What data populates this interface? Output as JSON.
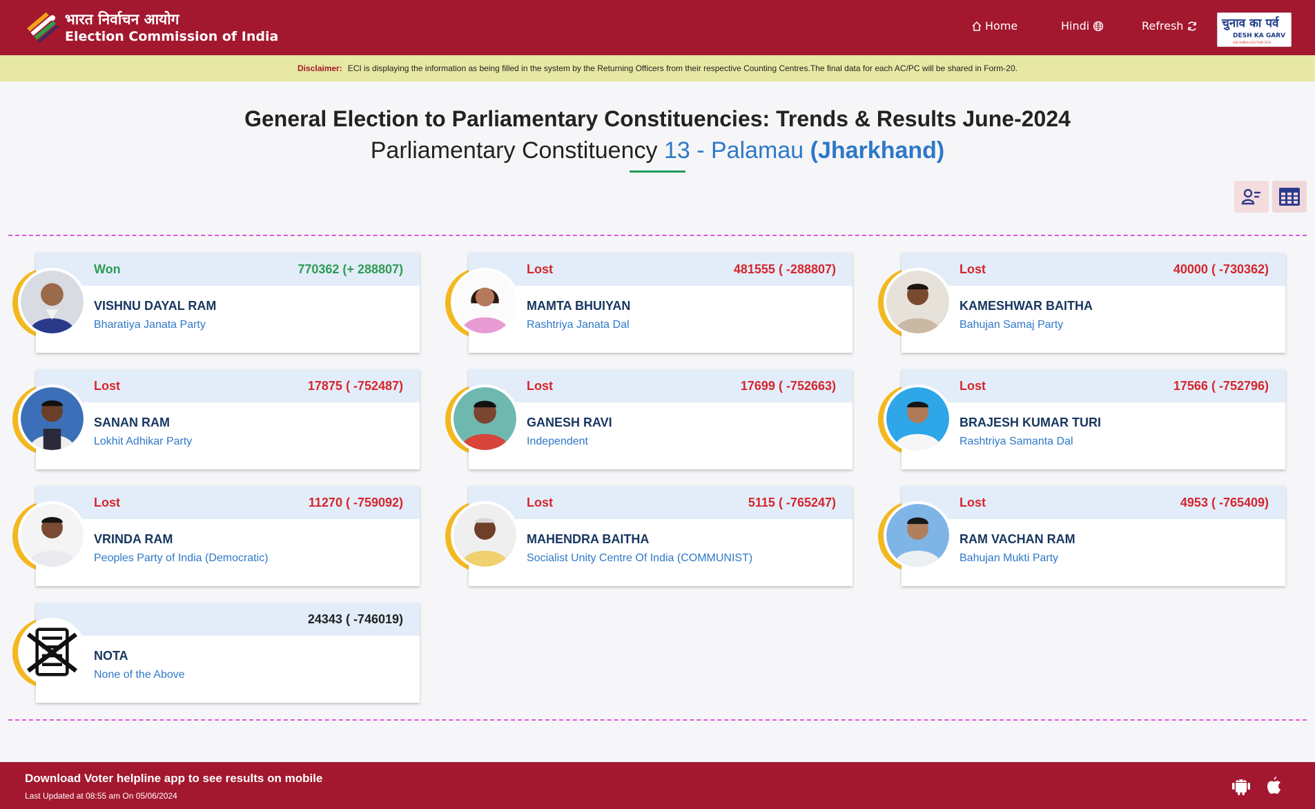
{
  "header": {
    "org_hindi": "भारत निर्वाचन आयोग",
    "org_english": "Election Commission of India",
    "nav": {
      "home": "Home",
      "hindi": "Hindi",
      "refresh": "Refresh"
    },
    "badge": {
      "hindi": "चुनाव का पर्व",
      "english": "DESH KA GARV",
      "tiny": "LOK SABHA ELECTION 2024"
    }
  },
  "disclaimer": {
    "label": "Disclaimer:",
    "text": "ECI is displaying the information as being filled in the system by the Returning Officers from their respective Counting Centres.The final data for each AC/PC will be shared in Form-20."
  },
  "title": {
    "line1": "General Election to Parliamentary Constituencies: Trends & Results June-2024",
    "line2_prefix": "Parliamentary Constituency",
    "pc_number_name": "13 - Palamau",
    "state": "(Jharkhand)"
  },
  "candidates": [
    {
      "status": "Won",
      "votes": "770362 (+ 288807)",
      "name": "VISHNU DAYAL RAM",
      "party": "Bharatiya Janata Party"
    },
    {
      "status": "Lost",
      "votes": "481555 ( -288807)",
      "name": "MAMTA BHUIYAN",
      "party": "Rashtriya Janata Dal"
    },
    {
      "status": "Lost",
      "votes": "40000 ( -730362)",
      "name": "KAMESHWAR BAITHA",
      "party": "Bahujan Samaj Party"
    },
    {
      "status": "Lost",
      "votes": "17875 ( -752487)",
      "name": "SANAN RAM",
      "party": "Lokhit Adhikar Party"
    },
    {
      "status": "Lost",
      "votes": "17699 ( -752663)",
      "name": "GANESH RAVI",
      "party": "Independent"
    },
    {
      "status": "Lost",
      "votes": "17566 ( -752796)",
      "name": "BRAJESH KUMAR TURI",
      "party": "Rashtriya Samanta Dal"
    },
    {
      "status": "Lost",
      "votes": "11270 ( -759092)",
      "name": "VRINDA RAM",
      "party": "Peoples Party of India (Democratic)"
    },
    {
      "status": "Lost",
      "votes": "5115 ( -765247)",
      "name": "MAHENDRA BAITHA",
      "party": "Socialist Unity Centre Of India (COMMUNIST)"
    },
    {
      "status": "Lost",
      "votes": "4953 ( -765409)",
      "name": "RAM VACHAN RAM",
      "party": "Bahujan Mukti Party"
    },
    {
      "status": "",
      "votes": "24343 ( -746019)",
      "name": "NOTA",
      "party": "None of the Above"
    }
  ],
  "footer": {
    "line1": "Download Voter helpline app to see results on mobile",
    "line2": "Last Updated at 08:55 am On 05/06/2024"
  },
  "colors": {
    "brand": "#a3182f",
    "won": "#2e9b55",
    "lost": "#d5252c",
    "accent_blue": "#2e78c7",
    "disclaimer_bg": "#e7e8a3"
  }
}
